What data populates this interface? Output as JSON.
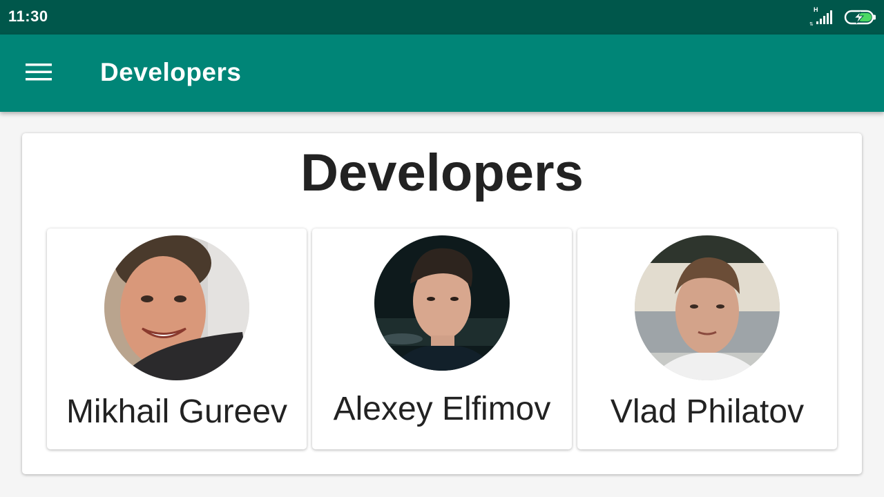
{
  "status_bar": {
    "time": "11:30",
    "network_type": "H",
    "icons": [
      "signal-icon",
      "battery-charging-icon"
    ]
  },
  "app_bar": {
    "menu_icon": "hamburger-menu-icon",
    "title": "Developers",
    "color": "#008577"
  },
  "content": {
    "heading": "Developers",
    "developers": [
      {
        "name": "Mikhail Gureev",
        "avatar": "avatar-photo"
      },
      {
        "name": "Alexey Elfimov",
        "avatar": "avatar-photo"
      },
      {
        "name": "Vlad Philatov",
        "avatar": "avatar-photo"
      }
    ]
  },
  "colors": {
    "status_bar": "#00574b",
    "app_bar": "#008577",
    "background": "#f5f5f5",
    "card": "#ffffff",
    "text": "#222222"
  }
}
